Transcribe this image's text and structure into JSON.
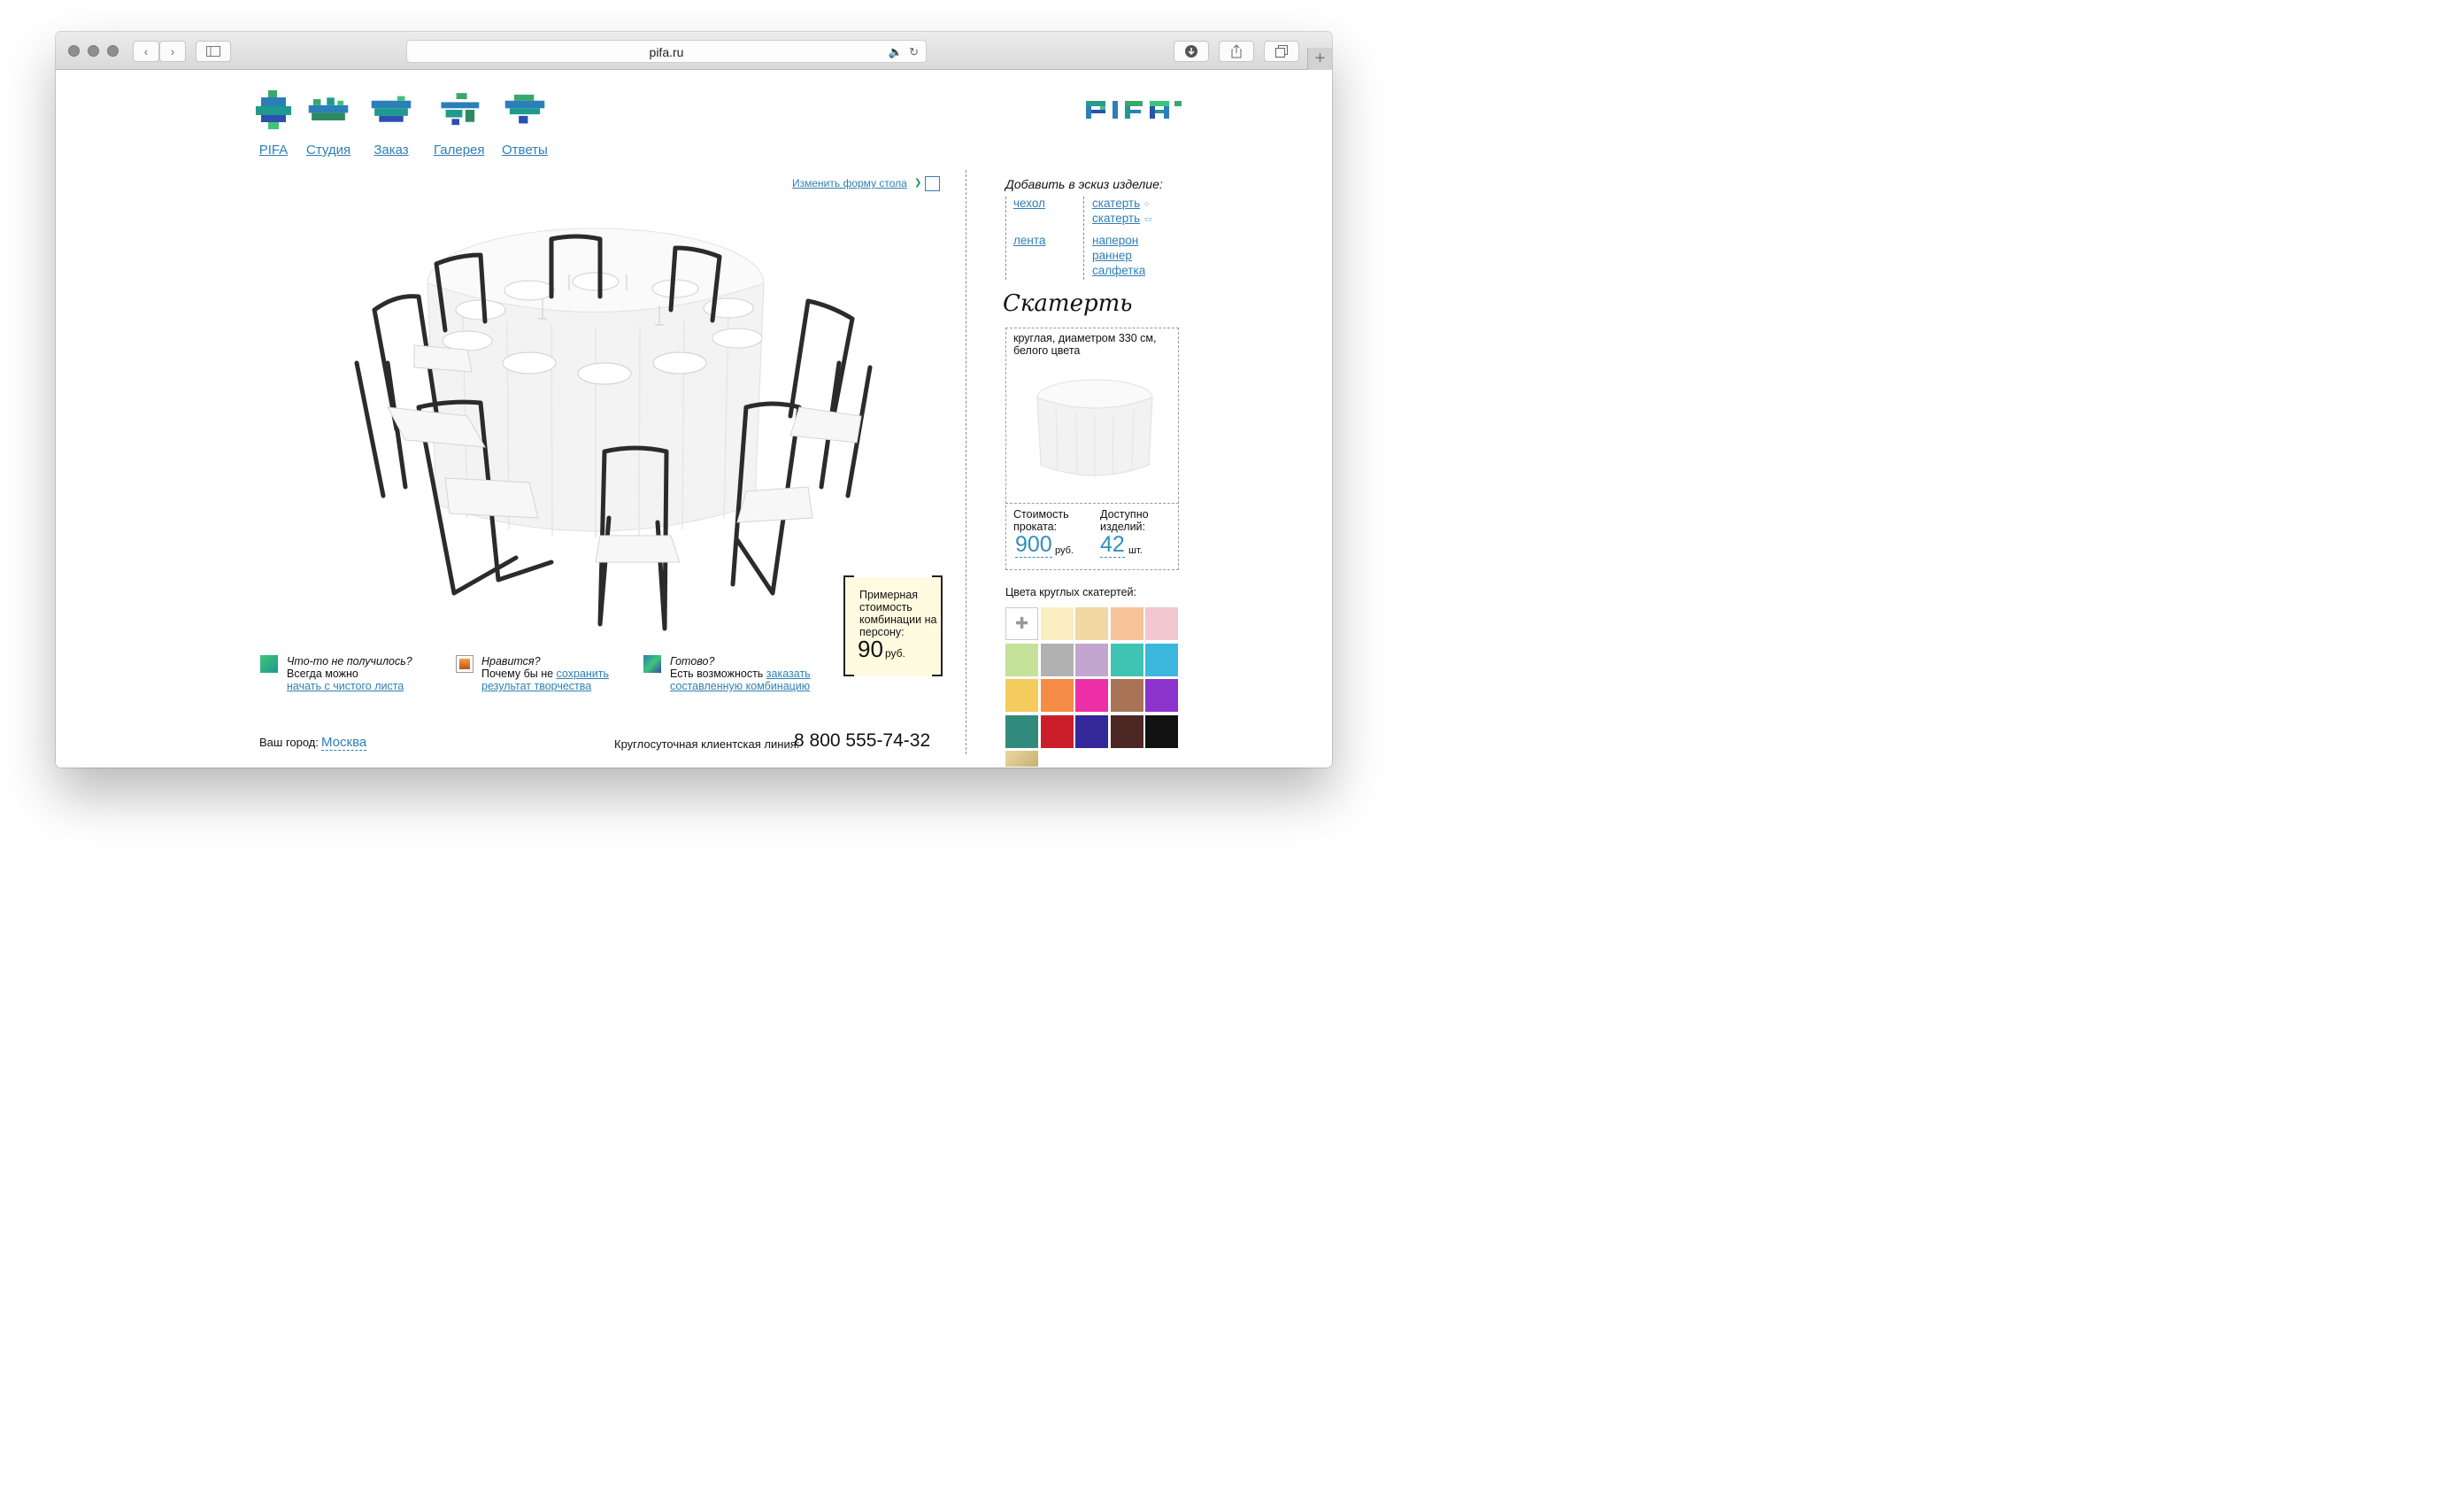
{
  "browser": {
    "url": "pifa.ru",
    "nav_buttons": [
      "back",
      "forward",
      "sidebar"
    ],
    "right_buttons": [
      "download",
      "share",
      "tabs"
    ]
  },
  "site": {
    "logo_text": "PIFA",
    "nav": [
      {
        "label": "PIFA",
        "icon": "pifa-nav-icon"
      },
      {
        "label": "Студия",
        "icon": "studio-nav-icon"
      },
      {
        "label": "Заказ",
        "icon": "order-nav-icon"
      },
      {
        "label": "Галерея",
        "icon": "gallery-nav-icon"
      },
      {
        "label": "Ответы",
        "icon": "answers-nav-icon"
      }
    ]
  },
  "editor": {
    "change_shape": "Изменить форму стола",
    "price": {
      "caption": "Примерная стоимость комбинации на персону:",
      "value": "90",
      "unit": "руб."
    }
  },
  "tips": [
    {
      "title": "Что-то не получилось?",
      "text": "Всегда можно",
      "link": "начать с чистого листа",
      "icon": "reset-icon"
    },
    {
      "title": "Нравится?",
      "text": "Почему бы не",
      "link": "сохранить",
      "link2": "результат творчества",
      "icon": "save-icon"
    },
    {
      "title": "Готово?",
      "text": "Есть возможность",
      "link": "заказать",
      "link2": "составленную комбинацию",
      "icon": "order-icon"
    }
  ],
  "footer": {
    "city_label": "Ваш город:",
    "city": "Москва",
    "hotline_label": "Круглосуточная клиентская линия:",
    "phone": "8 800 555-74-32"
  },
  "panel": {
    "add_title": "Добавить в эскиз изделие:",
    "items_left": [
      "чехол",
      "лента"
    ],
    "items_right": [
      "скатерть",
      "скатерть",
      "наперон",
      "раннер",
      "салфетка"
    ],
    "section_title": "Скатерть",
    "card": {
      "description": "круглая, диаметром 330 см, белого цвета",
      "rent_label": "Стоимость проката:",
      "rent_value": "900",
      "rent_unit": "руб.",
      "avail_label": "Доступно изделий:",
      "avail_value": "42",
      "avail_unit": "шт."
    },
    "colors_title": "Цвета круглых скатертей:",
    "colors": [
      "#fbeec0",
      "#f2d8a2",
      "#f7c49a",
      "#f1c6cf",
      "#c4e29a",
      "#b1b1b1",
      "#c2a6d0",
      "#3fc4b4",
      "#3db6dd",
      "#f4cb5d",
      "#f48c45",
      "#ec2fa6",
      "#a97355",
      "#8b33cc",
      "#318a7c",
      "#cc1d2a",
      "#34279a",
      "#4d2724",
      "#111111",
      "#d8c488"
    ]
  }
}
